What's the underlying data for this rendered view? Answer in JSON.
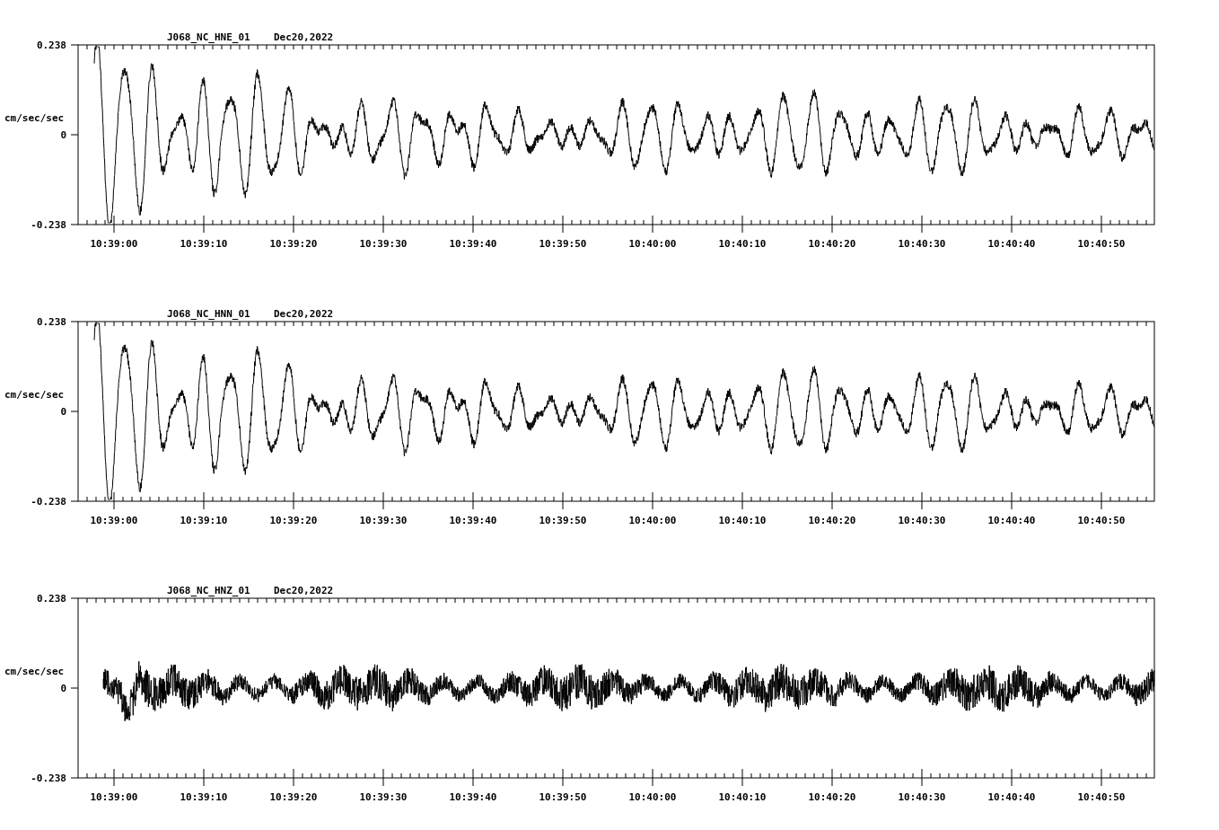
{
  "panels": [
    {
      "title": "J068_NC_HNE_01",
      "date": "Dec20,2022",
      "y_unit": "cm/sec/sec",
      "y_tick_labels": [
        "0.238",
        "0",
        "-0.238"
      ],
      "kind": "swell",
      "x_tick_labels": [
        "10:39:00",
        "10:39:10",
        "10:39:20",
        "10:39:30",
        "10:39:40",
        "10:39:50",
        "10:40:00",
        "10:40:10",
        "10:40:20",
        "10:40:30",
        "10:40:40",
        "10:40:50"
      ]
    },
    {
      "title": "J068_NC_HNN_01",
      "date": "Dec20,2022",
      "y_unit": "cm/sec/sec",
      "y_tick_labels": [
        "0.238",
        "0",
        "-0.238"
      ],
      "kind": "swell",
      "x_tick_labels": [
        "10:39:00",
        "10:39:10",
        "10:39:20",
        "10:39:30",
        "10:39:40",
        "10:39:50",
        "10:40:00",
        "10:40:10",
        "10:40:20",
        "10:40:30",
        "10:40:40",
        "10:40:50"
      ]
    },
    {
      "title": "J068_NC_HNZ_01",
      "date": "Dec20,2022",
      "y_unit": "cm/sec/sec",
      "y_tick_labels": [
        "0.238",
        "0",
        "-0.238"
      ],
      "kind": "noise",
      "x_tick_labels": [
        "10:39:00",
        "10:39:10",
        "10:39:20",
        "10:39:30",
        "10:39:40",
        "10:39:50",
        "10:40:00",
        "10:40:10",
        "10:40:20",
        "10:40:30",
        "10:40:40",
        "10:40:50"
      ]
    }
  ]
}
